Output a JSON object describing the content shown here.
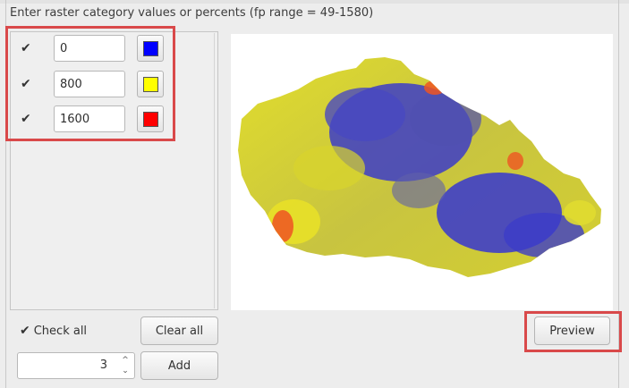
{
  "header": {
    "text": "Enter raster category values or percents (fp range = 49-1580)"
  },
  "rules": [
    {
      "value": "0",
      "checked": true,
      "color": "#0000ff",
      "color_name": "blue"
    },
    {
      "value": "800",
      "checked": true,
      "color": "#ffff00",
      "color_name": "yellow"
    },
    {
      "value": "1600",
      "checked": true,
      "color": "#ff0000",
      "color_name": "red"
    }
  ],
  "controls": {
    "check_all_label": "Check all",
    "check_all_checked": true,
    "clear_all_label": "Clear all",
    "add_count": "3",
    "add_label": "Add",
    "preview_label": "Preview"
  },
  "icons": {
    "check": "checkmark-icon",
    "spin_up": "spin-up-icon",
    "spin_down": "spin-down-icon"
  },
  "colors": {
    "highlight": "#d9494a",
    "map_low": "#3333cc",
    "map_mid": "#dddd22",
    "map_high": "#ee3311"
  }
}
